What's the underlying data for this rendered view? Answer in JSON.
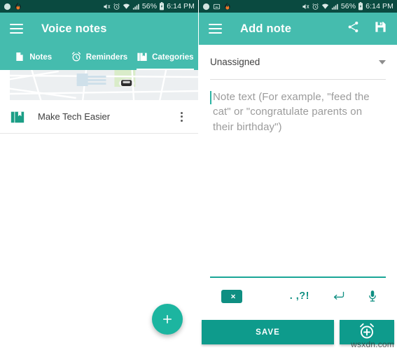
{
  "status_bar": {
    "left_icons_left_panel": [
      "moon-dnd-icon",
      "flame-app-icon"
    ],
    "left_icons_right_panel": [
      "moon-dnd-icon",
      "screenshot-icon",
      "flame-app-icon"
    ],
    "right_icons": [
      "mute-icon",
      "alarm-icon",
      "wifi-icon",
      "signal-icon",
      "battery-icon"
    ],
    "battery_percent": "56%",
    "time": "6:14 PM"
  },
  "colors": {
    "status_bar": "#0a4a40",
    "app_bar": "#45bcae",
    "accent": "#0e9b8c",
    "fab": "#1cb5a0",
    "keyboard_accent": "#0f8f82",
    "badge": "#e8705a"
  },
  "left_panel": {
    "app_bar": {
      "menu_icon": "hamburger-menu-icon",
      "title": "Voice notes"
    },
    "tabs": [
      {
        "label": "Notes",
        "icon": "note-page-icon",
        "active": false
      },
      {
        "label": "Reminders",
        "icon": "alarm-clock-icon",
        "active": false
      },
      {
        "label": "Categories",
        "icon": "categories-book-icon",
        "active": true
      }
    ],
    "map_card": {
      "icon": "car-marker-icon",
      "badge": "red-badge"
    },
    "list": [
      {
        "label": "Make Tech Easier",
        "icon": "categories-book-icon",
        "more_icon": "overflow-menu-icon"
      }
    ],
    "fab": {
      "icon": "plus-icon",
      "label": "+"
    }
  },
  "right_panel": {
    "app_bar": {
      "menu_icon": "hamburger-menu-icon",
      "title": "Add note",
      "actions": [
        {
          "name": "share-icon"
        },
        {
          "name": "save-disk-icon"
        }
      ]
    },
    "category_select": {
      "value": "Unassigned",
      "caret_icon": "chevron-down-icon"
    },
    "note_input": {
      "value": "",
      "placeholder": "Note text (For example, \"feed the cat\" or \"congratulate parents on their birthday\")"
    },
    "keyboard_bar": {
      "delete_icon": "backspace-delete-icon",
      "punctuation": ". ,?!",
      "enter_icon": "enter-return-icon",
      "mic_icon": "microphone-icon"
    },
    "buttons": {
      "save_label": "SAVE",
      "alarm_icon": "add-alarm-icon"
    }
  },
  "watermark": "wsxdn.com"
}
